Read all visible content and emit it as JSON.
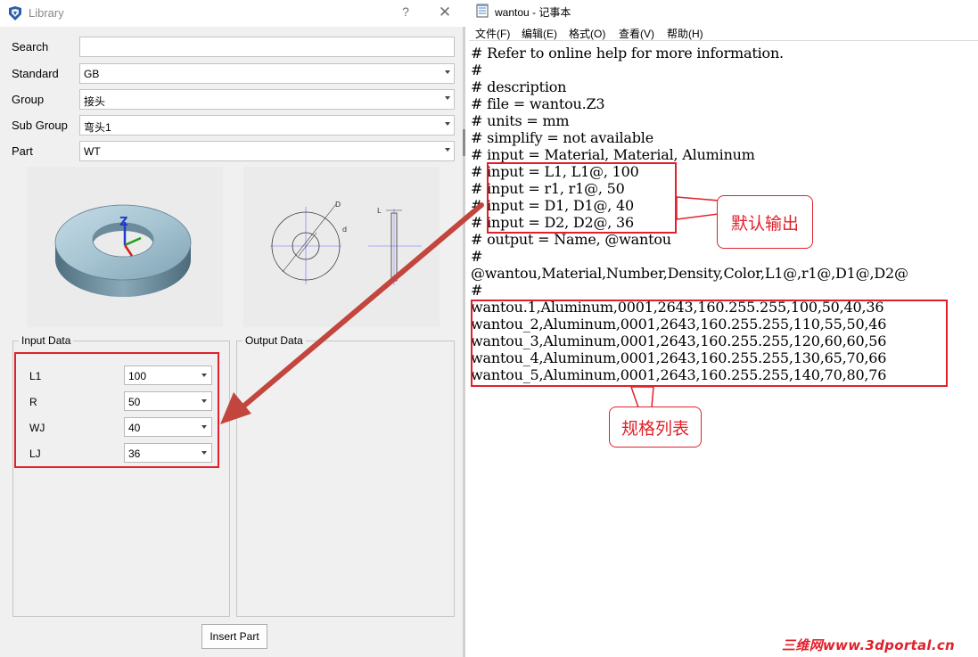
{
  "library": {
    "title": "Library",
    "help_glyph": "?",
    "close_glyph": "✕",
    "form": {
      "search": {
        "label": "Search",
        "value": ""
      },
      "standard": {
        "label": "Standard",
        "value": "GB"
      },
      "group": {
        "label": "Group",
        "value": "接头"
      },
      "subgroup": {
        "label": "Sub Group",
        "value": "弯头1"
      },
      "part": {
        "label": "Part",
        "value": "WT"
      }
    },
    "preview_2d_labels": {
      "D": "D",
      "d": "d",
      "L": "L"
    },
    "preview_3d_axis": "Z",
    "input_group": {
      "title": "Input Data",
      "rows": [
        {
          "label": "L1",
          "value": "100"
        },
        {
          "label": "R",
          "value": "50"
        },
        {
          "label": "WJ",
          "value": "40"
        },
        {
          "label": "LJ",
          "value": "36"
        }
      ]
    },
    "output_group": {
      "title": "Output Data"
    },
    "insert_button": "Insert Part"
  },
  "notepad": {
    "title": "wantou - 记事本",
    "menu": [
      "文件(F)",
      "编辑(E)",
      "格式(O)",
      "查看(V)",
      "帮助(H)"
    ],
    "lines": [
      "# Refer to online help for more information.",
      "#",
      "# description",
      "# file = wantou.Z3",
      "# units = mm",
      "# simplify = not available",
      "# input = Material, Material, Aluminum",
      "# input = L1, L1@, 100",
      "# input = r1, r1@, 50",
      "# input = D1, D1@, 40",
      "# input = D2, D2@, 36",
      "# output = Name, @wantou",
      "#",
      "@wantou,Material,Number,Density,Color,L1@,r1@,D1@,D2@",
      "#",
      "wantou.1,Aluminum,0001,2643,160.255.255,100,50,40,36",
      "wantou_2,Aluminum,0001,2643,160.255.255,110,55,50,46",
      "wantou_3,Aluminum,0001,2643,160.255.255,120,60,60,56",
      "wantou_4,Aluminum,0001,2643,160.255.255,130,65,70,66",
      "wantou_5,Aluminum,0001,2643,160.255.255,140,70,80,76"
    ]
  },
  "annotations": {
    "default_output_label": "默认输出",
    "spec_list_label": "规格列表",
    "color": "#e0212b"
  },
  "watermark": "三维网www.3dportal.cn"
}
